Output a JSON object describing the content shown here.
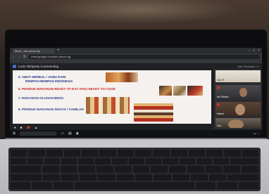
{
  "browser": {
    "tab_label": "Meet - ebx-yecw-rdg",
    "url": "meet.google.com/ebx-yecw-rdg"
  },
  "meeting": {
    "presenter_text": "Lovie Widyasty is presenting",
    "right_info": "Ade Paruwani +1",
    "participants": [
      {
        "name": "Zaki R."
      },
      {
        "name": "Ani Fitriani"
      },
      {
        "name": "Hasrul"
      },
      {
        "name": "You"
      }
    ]
  },
  "slide": {
    "items": [
      {
        "number": "5.",
        "text": "OBAT HERBAL / JAMU DARI"
      },
      {
        "number": "",
        "text": "REMPAH-REMPAH INDONESIA"
      },
      {
        "number": "6.",
        "text": "PRODUK MAKANAN READY TO EAT ATAU READY TO COOK"
      },
      {
        "number": "7.",
        "text": "MAKANAN OLAHAN BEKU"
      },
      {
        "number": "8.",
        "text": "PRODUK MAKANAN SNACK / CAMILAN"
      }
    ]
  },
  "icons": {
    "new_tab": "plus-icon",
    "back": "arrow-left-icon",
    "forward": "arrow-right-icon",
    "reload": "reload-icon",
    "windows": "windows-start-icon"
  },
  "colors": {
    "slide_primary": "#2d3a8c",
    "slide_highlight": "#c62020",
    "end_call": "#ea4335"
  }
}
